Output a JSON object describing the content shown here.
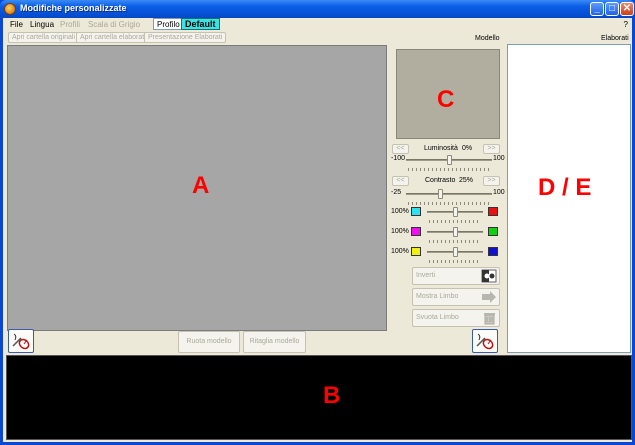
{
  "window": {
    "title": "Modifiche personalizzate",
    "controls": {
      "minimize": "_",
      "maximize": "□",
      "close": "✕"
    }
  },
  "menubar": {
    "items": [
      {
        "label": "File",
        "enabled": true
      },
      {
        "label": "Lingua",
        "enabled": true
      },
      {
        "label": "Profili",
        "enabled": false
      },
      {
        "label": "Scala di Grigio",
        "enabled": false
      }
    ],
    "profile_label": "Profilo",
    "profile_value": "Default",
    "help": "?"
  },
  "toolbar": {
    "open_original": "Apri cartella originali",
    "open_processed": "Apri cartella elaborati",
    "presentation": "Presentazione Elaborati"
  },
  "labels": {
    "model": "Modello",
    "processed": "Elaborati"
  },
  "regions": {
    "a": "A",
    "b": "B",
    "c": "C",
    "d": "D / E"
  },
  "brightness": {
    "title": "Luminosità",
    "value": "0%",
    "min": "-100",
    "max": "100",
    "left_btn": "<<",
    "right_btn": ">>",
    "level": 0.5
  },
  "contrast": {
    "title": "Contrasto",
    "value": "25%",
    "min": "-25",
    "max": "100",
    "left_btn": "<<",
    "right_btn": ">>",
    "level": 0.4
  },
  "color_channels": [
    {
      "value": "100%",
      "left_color": "#2ee0f0",
      "right_color": "#e81010",
      "level": 0.5
    },
    {
      "value": "100%",
      "left_color": "#ee10ee",
      "right_color": "#10d010",
      "level": 0.5
    },
    {
      "value": "100%",
      "left_color": "#f0f010",
      "right_color": "#1010d0",
      "level": 0.5
    }
  ],
  "side_buttons": {
    "invert": "Inverti",
    "show_limbo": "Mostra Limbo",
    "empty_limbo": "Svuota Limbo"
  },
  "bottom_buttons": {
    "rotate_model": "Ruota modello",
    "crop_model": "Ritaglia modello"
  },
  "colors": {
    "titlebar": "#0653d8",
    "accent_label": "#ff0000",
    "panel_a": "#a6a6a6",
    "panel_b": "#000000",
    "profile_highlight": "#3ce3e3"
  }
}
